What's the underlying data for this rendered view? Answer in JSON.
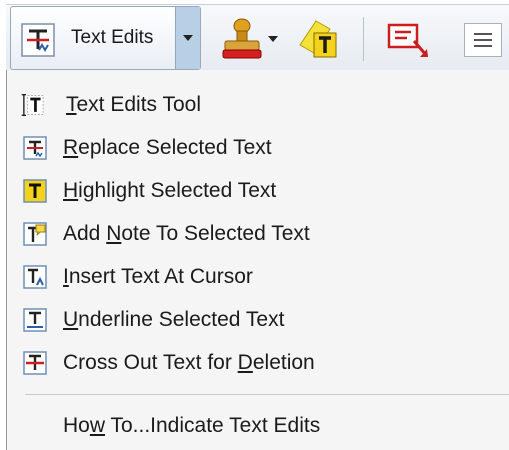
{
  "toolbar": {
    "text_edits_label": "Text Edits"
  },
  "menu": {
    "items": [
      {
        "pre": "",
        "key": "T",
        "post": "ext Edits Tool",
        "icon": "text-edits-tool-icon"
      },
      {
        "pre": "",
        "key": "R",
        "post": "eplace Selected Text",
        "icon": "replace-text-icon"
      },
      {
        "pre": "",
        "key": "H",
        "post": "ighlight Selected Text",
        "icon": "highlight-text-icon"
      },
      {
        "pre": "Add ",
        "key": "N",
        "post": "ote To Selected Text",
        "icon": "add-note-icon"
      },
      {
        "pre": "",
        "key": "I",
        "post": "nsert Text At Cursor",
        "icon": "insert-text-icon"
      },
      {
        "pre": "",
        "key": "U",
        "post": "nderline Selected Text",
        "icon": "underline-text-icon"
      },
      {
        "pre": "Cross Out Text for ",
        "key": "D",
        "post": "eletion",
        "icon": "cross-out-icon"
      }
    ],
    "howto": {
      "pre": "Ho",
      "key": "w",
      "post": " To...Indicate Text Edits"
    }
  },
  "colors": {
    "icon_red": "#cc1e1e",
    "icon_blue": "#2b5fa8",
    "highlight_yellow": "#f2d21a",
    "menu_bg": "#f5f5f5",
    "button_pressed": "#b9cfe6"
  }
}
